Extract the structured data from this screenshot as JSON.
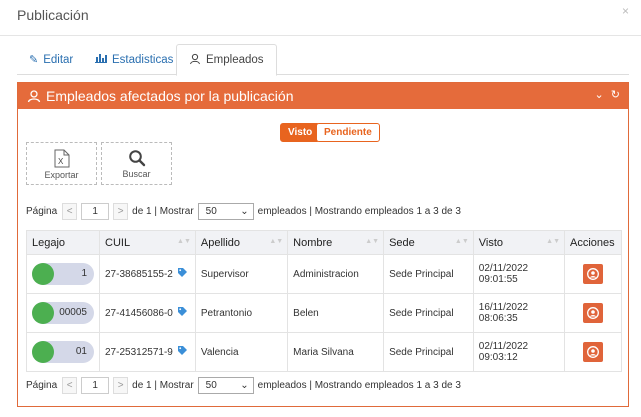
{
  "modal": {
    "title": "Publicación",
    "close": "×"
  },
  "tabs": [
    {
      "label": "Editar",
      "icon": "pencil-icon"
    },
    {
      "label": "Estadisticas",
      "icon": "bar-chart-icon"
    },
    {
      "label": "Empleados",
      "icon": "users-icon"
    }
  ],
  "panel": {
    "title": "Empleados afectados por la publicación",
    "tools": "⌄ ↻"
  },
  "filters": {
    "visto": "Visto",
    "pendiente": "Pendiente"
  },
  "actions": {
    "export": "Exportar",
    "search": "Buscar"
  },
  "pager": {
    "pagina": "Página",
    "prev": "<",
    "page": "1",
    "next": ">",
    "de": "de 1 | Mostrar",
    "per_page": "50",
    "summary": "empleados | Mostrando empleados 1 a 3 de 3"
  },
  "table": {
    "headers": [
      "Legajo",
      "CUIL",
      "Apellido",
      "Nombre",
      "Sede",
      "Visto",
      "Acciones"
    ],
    "rows": [
      {
        "legajo": "1",
        "cuil": "27-38685155-2",
        "apellido": "Supervisor",
        "nombre": "Administracion",
        "sede": "Sede Principal",
        "fecha": "02/11/2022",
        "hora": "09:01:55"
      },
      {
        "legajo": "00005",
        "cuil": "27-41456086-0",
        "apellido": "Petrantonio",
        "nombre": "Belen",
        "sede": "Sede Principal",
        "fecha": "16/11/2022",
        "hora": "08:06:35"
      },
      {
        "legajo": "01",
        "cuil": "27-25312571-9",
        "apellido": "Valencia",
        "nombre": "Maria Silvana",
        "sede": "Sede Principal",
        "fecha": "02/11/2022",
        "hora": "09:03:12"
      }
    ]
  },
  "colors": {
    "accent": "#e56b3b",
    "link": "#2a6fb0",
    "avatar": "#4caf50"
  }
}
